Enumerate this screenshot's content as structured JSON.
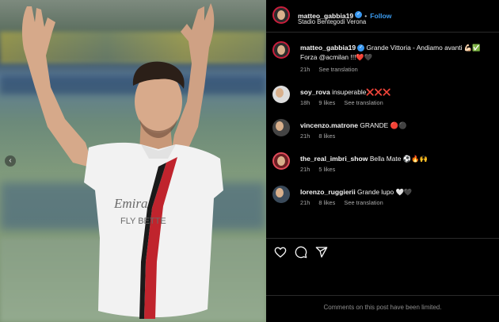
{
  "post": {
    "username": "matteo_gabbia19",
    "follow_label": "Follow",
    "dot": "•",
    "location": "Stadio Bentegodi Verona",
    "carousel_prev": "‹"
  },
  "caption": {
    "username": "matteo_gabbia19",
    "text": "Grande Vittoria - Andiamo avanti 💪🏻✅ Forza @acmilan !!!❤️🖤",
    "time": "21h",
    "see_translation": "See translation"
  },
  "comments": [
    {
      "username": "soy_rova",
      "text": "insuperable❌❌❌",
      "time": "18h",
      "likes": "9 likes",
      "see_translation": "See translation"
    },
    {
      "username": "vincenzo.matrone",
      "text": "GRANDE 🔴⚫",
      "time": "21h",
      "likes": "8 likes",
      "see_translation": ""
    },
    {
      "username": "the_real_imbri_show",
      "text": "Bella Mate ⚽🔥🙌",
      "time": "21h",
      "likes": "5 likes",
      "see_translation": ""
    },
    {
      "username": "lorenzo_ruggierii",
      "text": "Grande lupo 🤍🖤",
      "time": "21h",
      "likes": "8 likes",
      "see_translation": "See translation"
    }
  ],
  "actions": {
    "like": "heart-icon",
    "comment": "comment-icon",
    "share": "share-icon"
  },
  "footer": {
    "limited": "Comments on this post have been limited."
  },
  "shirt_sponsor": "Emirates FLY BETTER",
  "colors": {
    "background": "#000000",
    "link": "#3b9cf0",
    "secondary_text": "#a8a8a8",
    "shirt_stripe_red": "#c0242d",
    "shirt_stripe_black": "#1a1a1a"
  }
}
